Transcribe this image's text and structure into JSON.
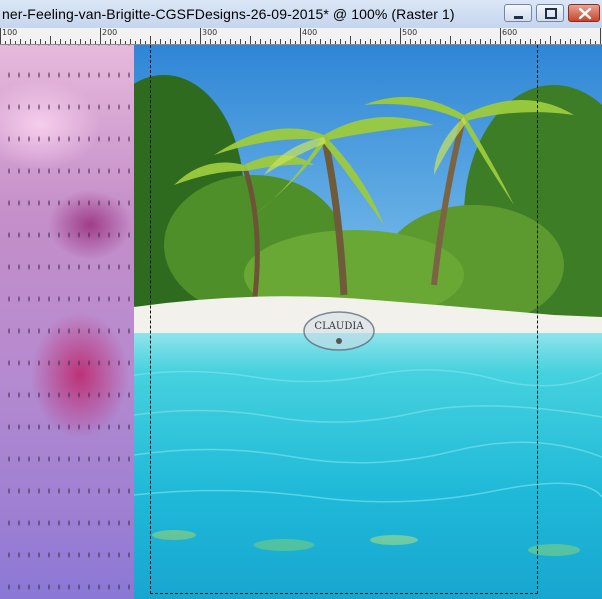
{
  "window": {
    "title": "ner-Feeling-van-Brigitte-CGSFDesigns-26-09-2015* @ 100% (Raster 1)",
    "icons": [
      "minimize-icon",
      "maximize-icon",
      "close-icon"
    ]
  },
  "ruler": {
    "labels": [
      "100",
      "200",
      "300",
      "400",
      "500",
      "600"
    ]
  },
  "canvas": {
    "watermark_text": "CLAUDIA"
  },
  "colors": {
    "sky": "#3a8fd4",
    "water": "#27c9dc",
    "sand": "#f3f1ec",
    "foliage": "#3f7f25",
    "close_button": "#c6452c"
  }
}
